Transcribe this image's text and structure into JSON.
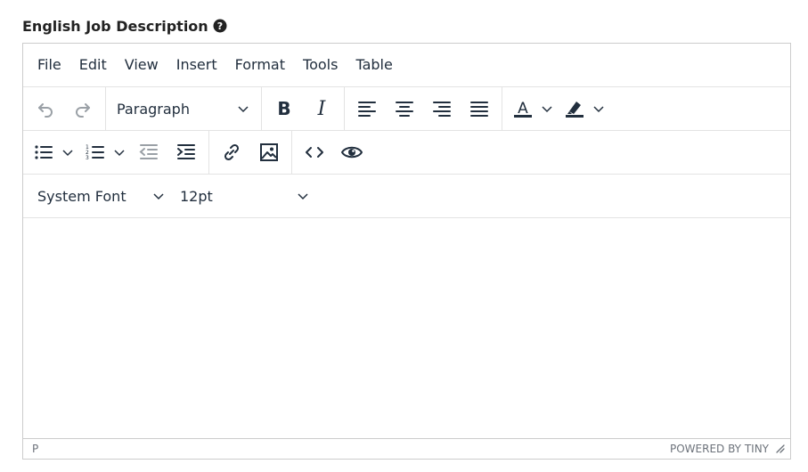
{
  "field": {
    "label": "English Job Description"
  },
  "menubar": {
    "items": [
      "File",
      "Edit",
      "View",
      "Insert",
      "Format",
      "Tools",
      "Table"
    ]
  },
  "toolbar": {
    "block_format": "Paragraph",
    "font_family": "System Font",
    "font_size": "12pt",
    "text_color": "#222f3e"
  },
  "statusbar": {
    "path": "P",
    "branding": "POWERED BY TINY"
  }
}
